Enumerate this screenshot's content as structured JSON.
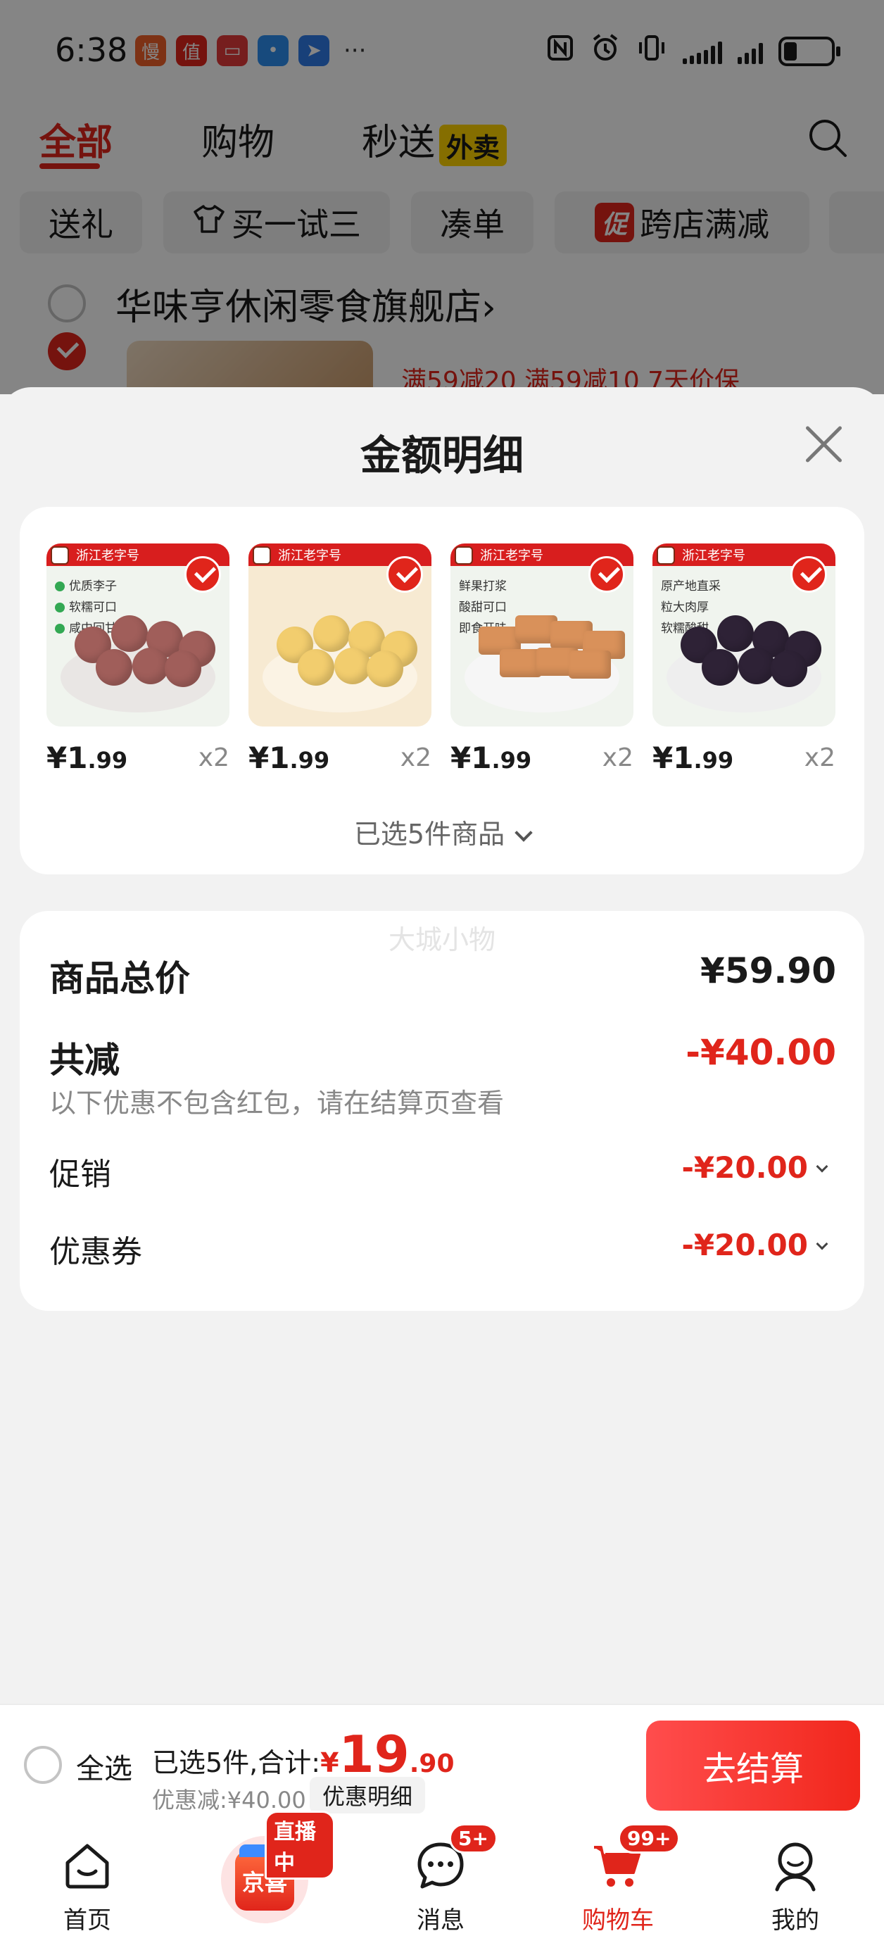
{
  "status_bar": {
    "time": "6:38",
    "app_badges": [
      {
        "glyph": "慢",
        "color": "#f0602a"
      },
      {
        "glyph": "值",
        "color": "#e0251b"
      },
      {
        "glyph": "▭",
        "color": "#e23b3b"
      },
      {
        "glyph": "•",
        "color": "#2c8ff0"
      },
      {
        "glyph": "➤",
        "color": "#2f7be8"
      }
    ],
    "more": "···",
    "icons": [
      "nfc-icon",
      "alarm-icon",
      "vibrate-icon",
      "signal-icon",
      "signal-icon",
      "battery-icon"
    ]
  },
  "top_tabs": {
    "all": "全部",
    "shopping": "购物",
    "instant": "秒送",
    "waimai_tag": "外卖"
  },
  "filters": {
    "gift": "送礼",
    "try_three": "买一试三",
    "combine": "凑单",
    "cu_tag": "促",
    "cross_store": "跨店满减"
  },
  "store": {
    "name": "华味亨休闲零食旗舰店",
    "chevron": "›",
    "promo": "满59减20  满59减10  7天价保"
  },
  "sheet": {
    "title": "金额明细",
    "products": [
      {
        "price_int": "¥1",
        "price_dec": ".99",
        "qty": "x2",
        "banner": "浙江老字号",
        "features": [
          "优质李子",
          "软糯可口",
          "咸中回甘"
        ],
        "plate": "#e9e6e4",
        "fruit": "#a05e5a"
      },
      {
        "price_int": "¥1",
        "price_dec": ".99",
        "qty": "x2",
        "banner": "浙江老字号",
        "features": [],
        "plate": "#fbf3e4",
        "fruit": "#f2cd6e"
      },
      {
        "price_int": "¥1",
        "price_dec": ".99",
        "qty": "x2",
        "banner": "浙江老字号",
        "features": [
          "鲜果打浆",
          "酸甜可口",
          "即食开味"
        ],
        "plate": "#f6f6f6",
        "fruit": "#d9915a"
      },
      {
        "price_int": "¥1",
        "price_dec": ".99",
        "qty": "x2",
        "banner": "浙江老字号",
        "features": [
          "原产地直采",
          "粒大肉厚",
          "软糯酸甜"
        ],
        "plate": "#eeeeee",
        "fruit": "#2e2236"
      }
    ],
    "selected_count": "已选5件商品",
    "watermark": "大城小物",
    "total_label": "商品总价",
    "total_value": "¥59.90",
    "reduce_label": "共减",
    "reduce_value": "-¥40.00",
    "note": "以下优惠不包含红包，请在结算页查看",
    "promo_label": "促销",
    "promo_value": "-¥20.00",
    "coupon_label": "优惠券",
    "coupon_value": "-¥20.00"
  },
  "checkout": {
    "select_all": "全选",
    "selected_prefix": "已选5件,合计:",
    "currency": "¥",
    "amount_int": "19",
    "amount_dec": ".90",
    "discount": "优惠减:¥40.00",
    "detail_button": "优惠明细",
    "checkout_button": "去结算"
  },
  "tabbar": {
    "home": "首页",
    "live_badge": "直播中",
    "jingxi": "京喜",
    "messages": "消息",
    "messages_badge": "5+",
    "cart": "购物车",
    "cart_badge": "99+",
    "mine": "我的"
  },
  "colors": {
    "accent": "#e0251b",
    "background": "#f2f2f2"
  }
}
